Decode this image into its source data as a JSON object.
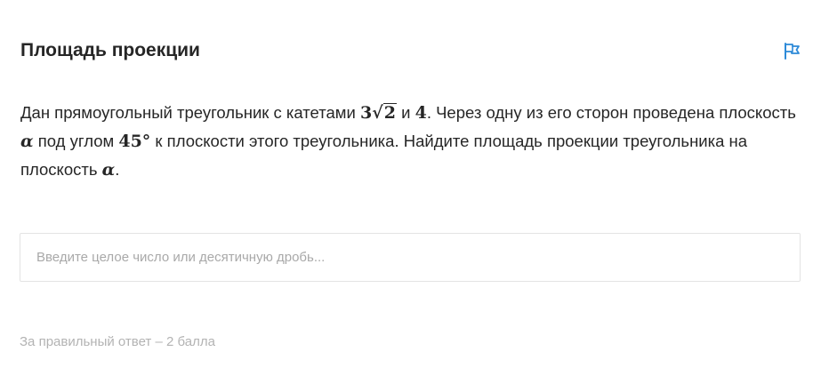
{
  "task": {
    "title": "Площадь проекции",
    "flag_icon_color": "#2d8ad8",
    "text": {
      "part1": "Дан прямоугольный треугольник с катетами ",
      "leg1_coef": "3",
      "leg1_radical": "√",
      "leg1_radicand": "2",
      "part2": " и ",
      "leg2": "4",
      "part3": ". Через одну из его сторон проведена плоскость ",
      "plane_symbol": "α",
      "part4": " под углом ",
      "angle": "45°",
      "part5": " к плоскости этого треугольника. Найдите площадь проекции треугольника на плоскость ",
      "plane_symbol_2": "α",
      "part6": "."
    }
  },
  "answer": {
    "placeholder": "Введите целое число или десятичную дробь...",
    "value": ""
  },
  "footer": {
    "points_text": "За правильный ответ – 2 балла"
  },
  "colors": {
    "text": "#262626",
    "muted": "#b3b3b3",
    "border": "#e3e3e3",
    "accent": "#2d8ad8"
  }
}
